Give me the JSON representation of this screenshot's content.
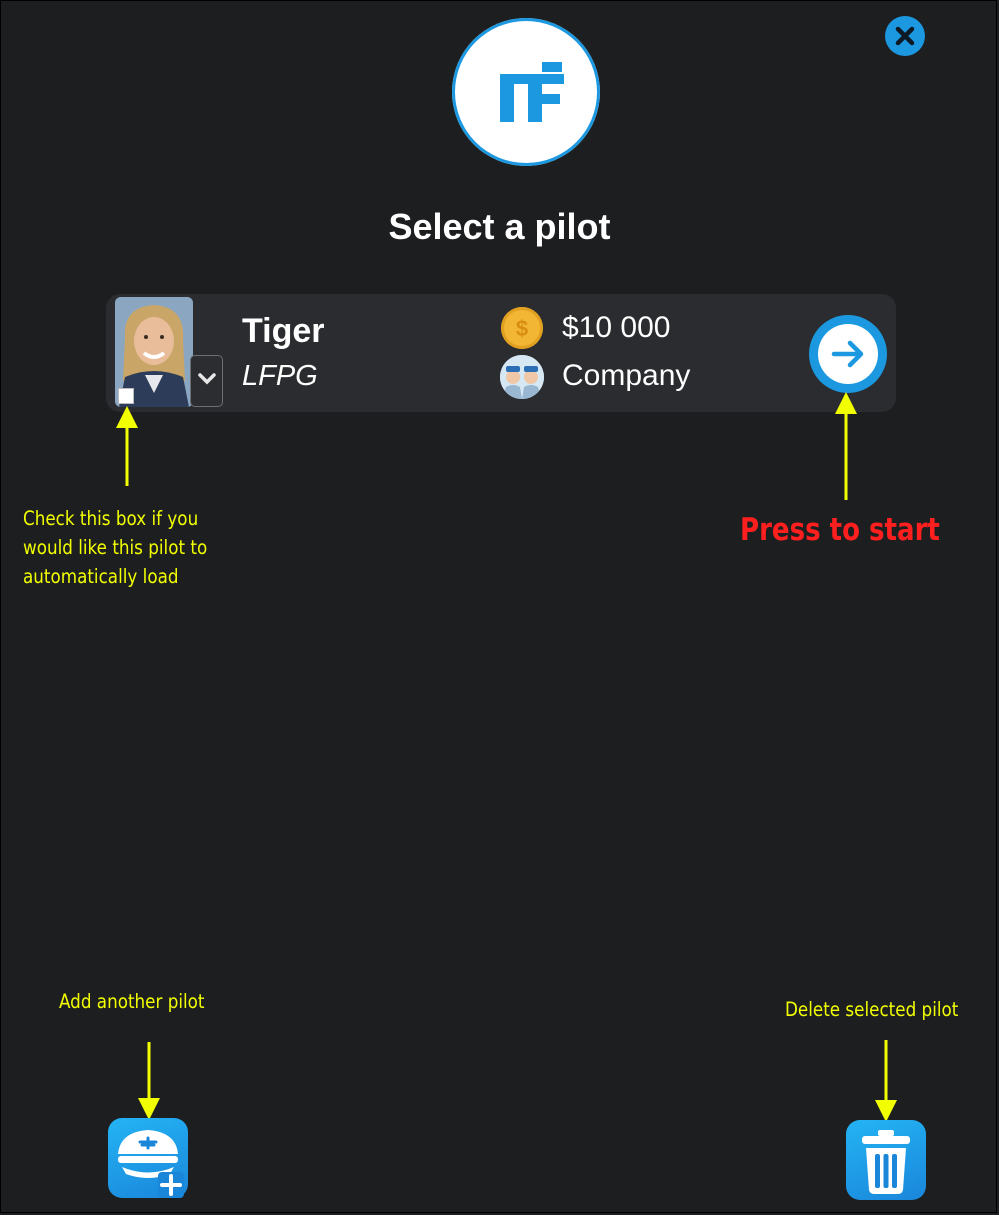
{
  "header": {
    "title": "Select a pilot",
    "close_icon": "close-icon",
    "logo_icon": "nf-logo-icon"
  },
  "pilot": {
    "name": "Tiger",
    "airport": "LFPG",
    "money": "$10 000",
    "affiliation": "Company",
    "avatar_icon": "pilot-portrait",
    "autoload_checked": false
  },
  "annotations": {
    "checkbox_hint_lines": [
      "Check this box if you",
      "would like this pilot to",
      "automatically load"
    ],
    "start_hint": "Press to start",
    "add_hint": "Add another pilot",
    "delete_hint": "Delete selected pilot"
  },
  "colors": {
    "background": "#1d1e20",
    "card": "#2a2c2f",
    "accent": "#1c98e0",
    "annotation": "#f2ff00",
    "start_hint": "#ff1f1f",
    "coin": "#f3b634"
  }
}
